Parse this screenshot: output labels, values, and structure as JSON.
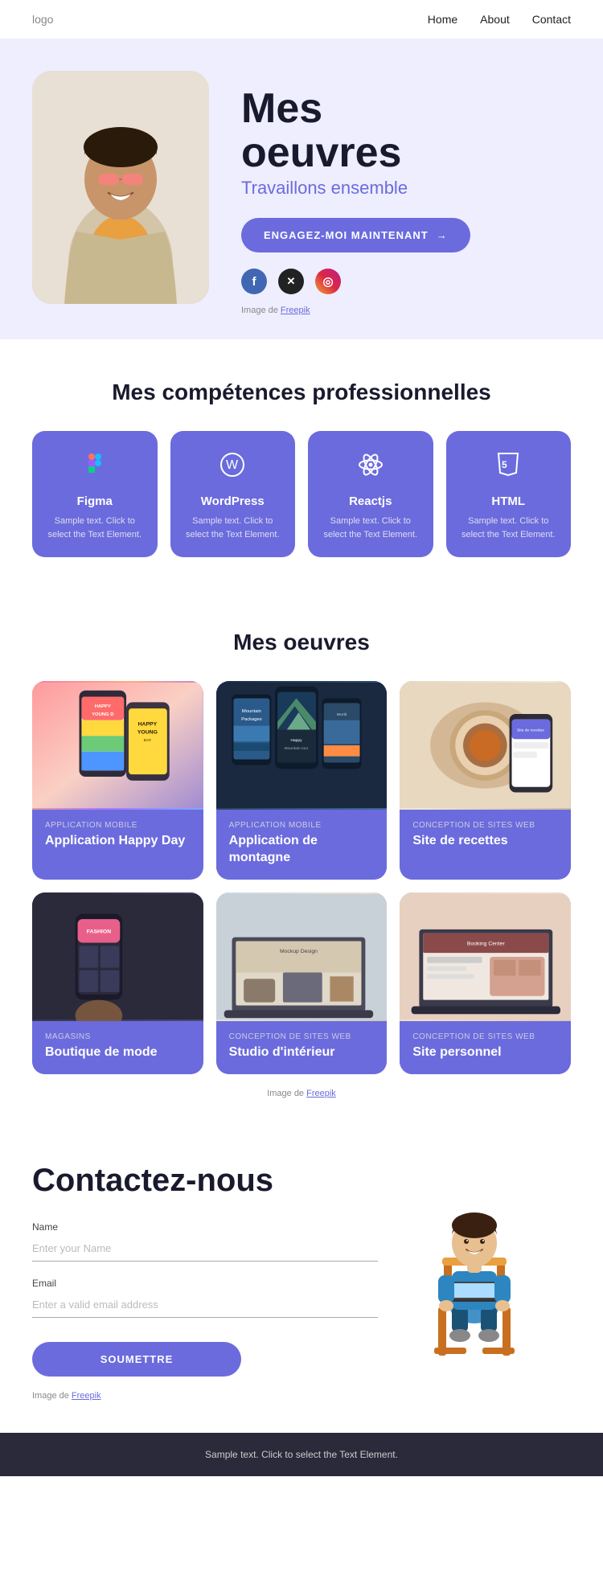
{
  "nav": {
    "logo": "logo",
    "links": [
      "Home",
      "About",
      "Contact"
    ]
  },
  "hero": {
    "title_line1": "Mes",
    "title_line2": "oeuvres",
    "subtitle": "Travaillons ensemble",
    "cta_label": "ENGAGEZ-MOI MAINTENANT",
    "cta_arrow": "→",
    "socials": [
      "facebook",
      "x-twitter",
      "instagram"
    ],
    "freepik_text": "Image de ",
    "freepik_link": "Freepik"
  },
  "skills": {
    "section_title": "Mes compétences professionnelles",
    "cards": [
      {
        "icon": "✦",
        "name": "Figma",
        "desc": "Sample text. Click to select the Text Element."
      },
      {
        "icon": "⊞",
        "name": "WordPress",
        "desc": "Sample text. Click to select the Text Element."
      },
      {
        "icon": "⚛",
        "name": "Reactjs",
        "desc": "Sample text. Click to select the Text Element."
      },
      {
        "icon": "⬡",
        "name": "HTML",
        "desc": "Sample text. Click to select the Text Element."
      }
    ]
  },
  "works": {
    "section_title": "Mes oeuvres",
    "cards": [
      {
        "id": 1,
        "category": "APPLICATION MOBILE",
        "title": "Application Happy Day"
      },
      {
        "id": 2,
        "category": "APPLICATION MOBILE",
        "title": "Application de montagne"
      },
      {
        "id": 3,
        "category": "CONCEPTION DE SITES WEB",
        "title": "Site de recettes"
      },
      {
        "id": 4,
        "category": "MAGASINS",
        "title": "Boutique de mode"
      },
      {
        "id": 5,
        "category": "CONCEPTION DE SITES WEB",
        "title": "Studio d'intérieur"
      },
      {
        "id": 6,
        "category": "CONCEPTION DE SITES WEB",
        "title": "Site personnel"
      }
    ],
    "freepik_text": "Image de ",
    "freepik_link": "Freepik"
  },
  "contact": {
    "title": "Contactez-nous",
    "name_label": "Name",
    "name_placeholder": "Enter your Name",
    "email_label": "Email",
    "email_placeholder": "Enter a valid email address",
    "submit_label": "SOUMETTRE",
    "freepik_text": "Image de ",
    "freepik_link": "Freepik"
  },
  "footer": {
    "text": "Sample text. Click to select the Text Element."
  }
}
